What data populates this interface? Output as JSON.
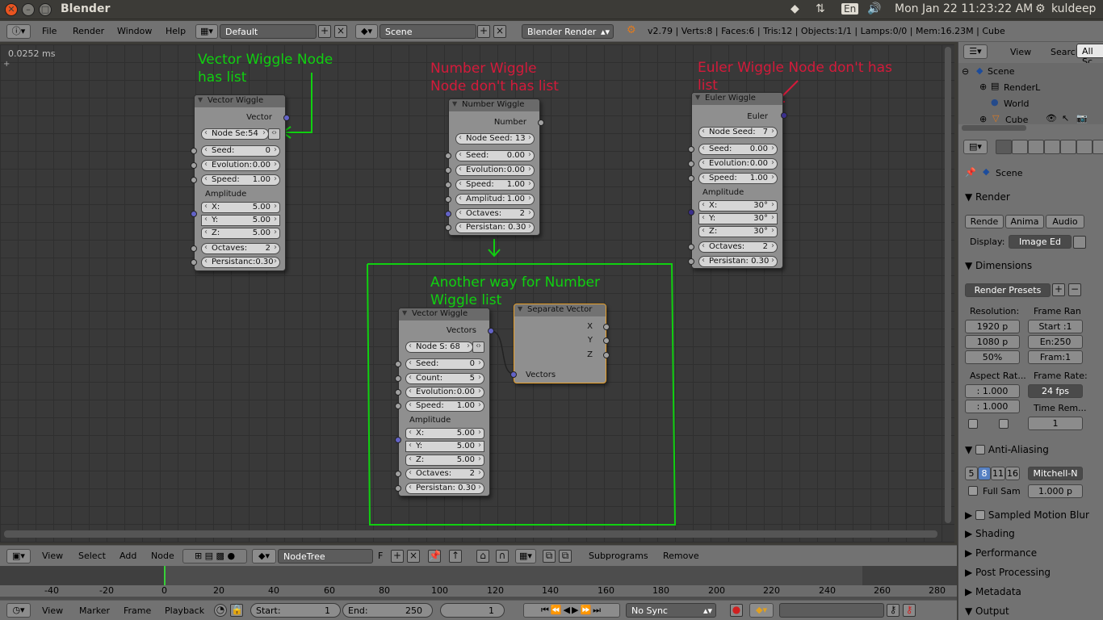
{
  "titlebar": {
    "title": "Blender",
    "lang": "En",
    "clock": "Mon Jan 22 11:23:22 AM",
    "user": "kuldeep"
  },
  "topmenu": {
    "items": [
      "File",
      "Render",
      "Window",
      "Help"
    ],
    "layout": "Default",
    "scene": "Scene",
    "engine": "Blender Render",
    "stats": "v2.79 | Verts:8 | Faces:6 | Tris:12 | Objects:1/1 | Lamps:0/0 | Mem:16.23M | Cube"
  },
  "editor": {
    "timing": "0.0252 ms"
  },
  "annotations": {
    "vector_list": [
      "Vector Wiggle Node",
      "has list"
    ],
    "number_nolist": [
      "Number Wiggle",
      "Node don't has list"
    ],
    "euler_nolist": [
      "Euler Wiggle Node don't has",
      "list"
    ],
    "another_way": [
      "Another way for Number",
      "Wiggle list"
    ]
  },
  "node_vector1": {
    "title": "Vector Wiggle",
    "output": "Vector",
    "node_seed": "Node Se:54",
    "seed_label": "Seed:",
    "seed_val": "0",
    "evol_label": "Evolution:",
    "evol_val": "0.00",
    "speed_label": "Speed:",
    "speed_val": "1.00",
    "amp": "Amplitude",
    "x_label": "X:",
    "x_val": "5.00",
    "y_label": "Y:",
    "y_val": "5.00",
    "z_label": "Z:",
    "z_val": "5.00",
    "oct_label": "Octaves:",
    "oct_val": "2",
    "pers": "Persistanc:0.30"
  },
  "node_number": {
    "title": "Number Wiggle",
    "output": "Number",
    "node_seed": "Node Seed: 13",
    "seed_label": "Seed:",
    "seed_val": "0.00",
    "evol_label": "Evolution:",
    "evol_val": "0.00",
    "speed_label": "Speed:",
    "speed_val": "1.00",
    "amp_label": "Amplitud:",
    "amp_val": "1.00",
    "oct_label": "Octaves:",
    "oct_val": "2",
    "pers": "Persistan: 0.30"
  },
  "node_euler": {
    "title": "Euler Wiggle",
    "output": "Euler",
    "seed_label": "Node Seed:",
    "seed_num": "7",
    "s_label": "Seed:",
    "s_val": "0.00",
    "evol_label": "Evolution:",
    "evol_val": "0.00",
    "speed_label": "Speed:",
    "speed_val": "1.00",
    "amp": "Amplitude",
    "x_label": "X:",
    "x_val": "30°",
    "y_label": "Y:",
    "y_val": "30°",
    "z_label": "Z:",
    "z_val": "30°",
    "oct_label": "Octaves:",
    "oct_val": "2",
    "pers": "Persistan: 0.30"
  },
  "node_vector2": {
    "title": "Vector Wiggle",
    "output": "Vectors",
    "node_seed": "Node S: 68",
    "seed_label": "Seed:",
    "seed_val": "0",
    "count_label": "Count:",
    "count_val": "5",
    "evol_label": "Evolution:",
    "evol_val": "0.00",
    "speed_label": "Speed:",
    "speed_val": "1.00",
    "amp": "Amplitude",
    "x_label": "X:",
    "x_val": "5.00",
    "y_label": "Y:",
    "y_val": "5.00",
    "z_label": "Z:",
    "z_val": "5.00",
    "oct_label": "Octaves:",
    "oct_val": "2",
    "pers": "Persistan: 0.30"
  },
  "node_separate": {
    "title": "Separate Vector",
    "x": "X",
    "y": "Y",
    "z": "Z",
    "input": "Vectors"
  },
  "nodeheader": {
    "items": [
      "View",
      "Select",
      "Add",
      "Node"
    ],
    "tree": "NodeTree",
    "fake": "F",
    "subprograms": "Subprograms",
    "remove": "Remove"
  },
  "timeline": {
    "ticks": [
      "-40",
      "-20",
      "0",
      "20",
      "40",
      "60",
      "80",
      "100",
      "120",
      "140",
      "160",
      "180",
      "200",
      "220",
      "240",
      "260",
      "280"
    ],
    "menu": [
      "View",
      "Marker",
      "Frame",
      "Playback"
    ],
    "start": "Start:",
    "start_val": "1",
    "end": "End:",
    "end_val": "250",
    "current": "1",
    "sync": "No Sync"
  },
  "outliner": {
    "view": "View",
    "search": "Search",
    "all": "All Sc",
    "items": [
      "Scene",
      "RenderL",
      "World",
      "Cube"
    ]
  },
  "properties": {
    "context": "Scene",
    "render": "Render",
    "render_btn": "Rende",
    "anim_btn": "Anima",
    "audio_btn": "Audio",
    "display_label": "Display:",
    "display_val": "Image Ed",
    "dimensions": "Dimensions",
    "presets": "Render Presets",
    "resolution": "Resolution:",
    "frame_range": "Frame Ran",
    "res_x": "1920 p",
    "res_y": "1080 p",
    "res_pct": "50%",
    "start": "Start :1",
    "end": "En:250",
    "step": "Fram:1",
    "aspect": "Aspect Rat...",
    "framerate": "Frame Rate:",
    "asp_x": ": 1.000",
    "asp_y": ": 1.000",
    "fps": "24 fps",
    "time_rem": "Time Rem...",
    "time_val": "1",
    "aa": "Anti-Aliasing",
    "aa_samples": [
      "5",
      "8",
      "11",
      "16"
    ],
    "aa_filter": "Mitchell-N",
    "full_sample": "Full Sam",
    "filter_size": "1.000 p",
    "sections": [
      "Sampled Motion Blur",
      "Shading",
      "Performance",
      "Post Processing",
      "Metadata",
      "Output"
    ]
  }
}
